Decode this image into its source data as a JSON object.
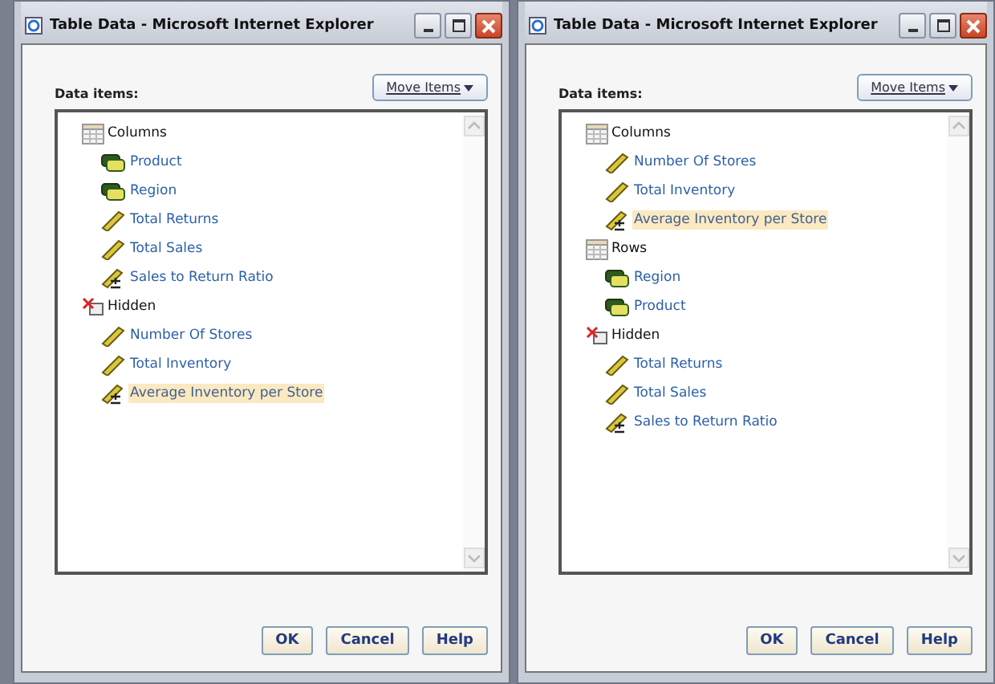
{
  "windows": [
    {
      "title": "Table Data - Microsoft Internet Explorer",
      "label": "Data items:",
      "move_button": "Move Items",
      "groups": [
        {
          "name": "Columns",
          "kind": "axis",
          "items": [
            {
              "label": "Product",
              "kind": "dimension",
              "selected": false
            },
            {
              "label": "Region",
              "kind": "dimension",
              "selected": false
            },
            {
              "label": "Total Returns",
              "kind": "measure",
              "selected": false
            },
            {
              "label": "Total Sales",
              "kind": "measure",
              "selected": false
            },
            {
              "label": "Sales to Return Ratio",
              "kind": "calculated",
              "selected": false
            }
          ]
        },
        {
          "name": "Hidden",
          "kind": "hidden",
          "items": [
            {
              "label": "Number Of Stores",
              "kind": "measure",
              "selected": false
            },
            {
              "label": "Total Inventory",
              "kind": "measure",
              "selected": false
            },
            {
              "label": "Average Inventory per Store",
              "kind": "calculated",
              "selected": true
            }
          ]
        }
      ],
      "buttons": [
        "OK",
        "Cancel",
        "Help"
      ]
    },
    {
      "title": "Table Data - Microsoft Internet Explorer",
      "label": "Data items:",
      "move_button": "Move Items",
      "groups": [
        {
          "name": "Columns",
          "kind": "axis",
          "items": [
            {
              "label": "Number Of Stores",
              "kind": "measure",
              "selected": false
            },
            {
              "label": "Total Inventory",
              "kind": "measure",
              "selected": false
            },
            {
              "label": "Average Inventory per Store",
              "kind": "calculated",
              "selected": true
            }
          ]
        },
        {
          "name": "Rows",
          "kind": "axis",
          "items": [
            {
              "label": "Region",
              "kind": "dimension",
              "selected": false
            },
            {
              "label": "Product",
              "kind": "dimension",
              "selected": false
            }
          ]
        },
        {
          "name": "Hidden",
          "kind": "hidden",
          "items": [
            {
              "label": "Total Returns",
              "kind": "measure",
              "selected": false
            },
            {
              "label": "Total Sales",
              "kind": "measure",
              "selected": false
            },
            {
              "label": "Sales to Return Ratio",
              "kind": "calculated",
              "selected": false
            }
          ]
        }
      ],
      "buttons": [
        "OK",
        "Cancel",
        "Help"
      ]
    }
  ]
}
